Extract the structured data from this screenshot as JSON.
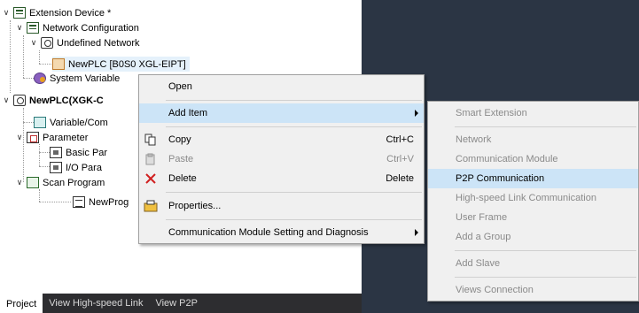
{
  "tree": {
    "extension_device": "Extension Device *",
    "network_configuration": "Network Configuration",
    "undefined_network": "Undefined Network",
    "newplc_network": "NewPLC [B0S0 XGL-EIPT]",
    "system_variable": "System Variable",
    "newplc": "NewPLC(XGK-C",
    "variable_comment": "Variable/Com",
    "parameter": "Parameter",
    "basic_parameter": "Basic Par",
    "io_parameter": "I/O Para",
    "scan_program": "Scan Program",
    "new_program": "NewProg"
  },
  "bottom_tabs": [
    "Project",
    "View High-speed Link",
    "View P2P"
  ],
  "context_menu": {
    "open": "Open",
    "add_item": "Add Item",
    "copy": "Copy",
    "copy_shortcut": "Ctrl+C",
    "paste": "Paste",
    "paste_shortcut": "Ctrl+V",
    "delete": "Delete",
    "delete_shortcut": "Delete",
    "properties": "Properties...",
    "comm_setting": "Communication Module Setting and Diagnosis"
  },
  "submenu": {
    "smart_extension": "Smart Extension",
    "network": "Network",
    "communication_module": "Communication Module",
    "p2p_communication": "P2P Communication",
    "high_speed_link": "High-speed Link Communication",
    "user_frame": "User Frame",
    "add_group": "Add a Group",
    "add_slave": "Add Slave",
    "views_connection": "Views Connection"
  },
  "colors": {
    "menu_bg": "#f0f0f0",
    "hover": "#cce4f7",
    "dark_bg": "#2b3544",
    "disabled_text": "#8a8a8a"
  }
}
